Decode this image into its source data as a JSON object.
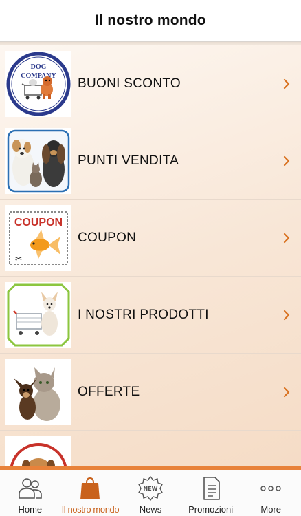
{
  "header": {
    "title": "Il nostro mondo"
  },
  "list": {
    "items": [
      {
        "label": "BUONI SCONTO",
        "image": "dog-company-logo",
        "logo_text_top": "DOG",
        "logo_text_bottom": "COMPANY"
      },
      {
        "label": "PUNTI VENDITA",
        "image": "dogs-and-cat-photo"
      },
      {
        "label": "COUPON",
        "image": "coupon-goldfish",
        "coupon_text": "COUPON"
      },
      {
        "label": "I NOSTRI PRODOTTI",
        "image": "dog-in-cart-photo"
      },
      {
        "label": "OFFERTE",
        "image": "cat-and-chihuahua-photo"
      },
      {
        "label": "",
        "image": "dog-partial-photo"
      }
    ]
  },
  "tabbar": {
    "tabs": [
      {
        "label": "Home",
        "icon": "people-icon",
        "active": false
      },
      {
        "label": "Il nostro mondo",
        "icon": "shopping-bag-icon",
        "active": true
      },
      {
        "label": "News",
        "icon": "new-badge-icon",
        "active": false
      },
      {
        "label": "Promozioni",
        "icon": "document-icon",
        "active": false
      },
      {
        "label": "More",
        "icon": "more-dots-icon",
        "active": false
      }
    ],
    "new_badge_text": "NEW"
  },
  "colors": {
    "accent": "#e8823a",
    "active_label": "#c9621c",
    "chevron": "#d9711f"
  }
}
